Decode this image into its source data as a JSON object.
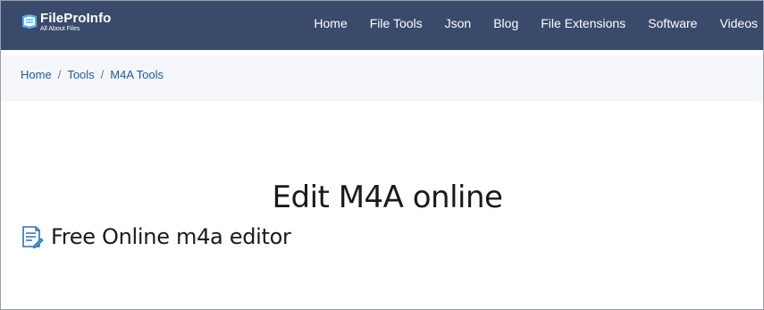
{
  "header": {
    "logo_name": "FileProInfo",
    "logo_tagline": "All About Files",
    "nav": [
      "Home",
      "File Tools",
      "Json",
      "Blog",
      "File Extensions",
      "Software",
      "Videos"
    ]
  },
  "breadcrumb": [
    "Home",
    "Tools",
    "M4A Tools"
  ],
  "main": {
    "title": "Edit M4A online",
    "subtitle": "Free Online m4a editor"
  },
  "colors": {
    "header_bg": "#3a4a6b",
    "breadcrumb_bg": "#f4f6fa",
    "link": "#1f5aa6"
  }
}
